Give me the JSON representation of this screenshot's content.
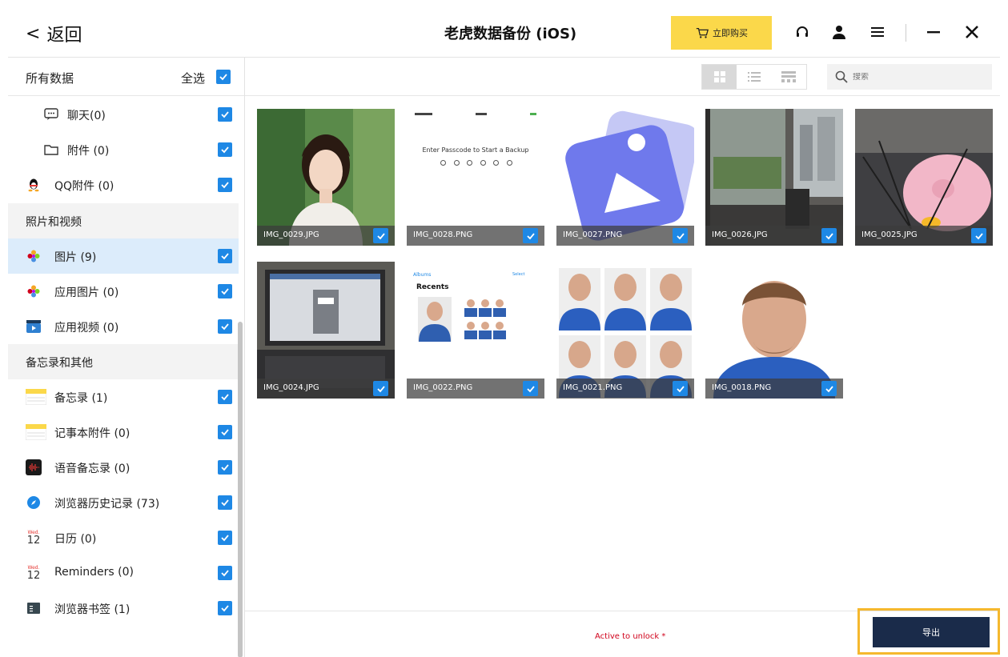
{
  "titlebar": {
    "back_label": "返回",
    "title": "老虎数据备份 (iOS)",
    "buy_label": "立即购买"
  },
  "sidebar": {
    "header_label": "所有数据",
    "select_all_label": "全选",
    "items": [
      {
        "label": "聊天(0)",
        "icon": "chat-bubble-icon",
        "type": "sub"
      },
      {
        "label": "附件 (0)",
        "icon": "folder-icon",
        "type": "sub"
      },
      {
        "label": "QQ附件 (0)",
        "icon": "qq-penguin-icon",
        "type": "item"
      }
    ],
    "section_photos": "照片和视频",
    "photo_items": [
      {
        "label": "图片 (9)",
        "icon": "photos-flower-icon"
      },
      {
        "label": "应用图片 (0)",
        "icon": "photos-flower-icon"
      },
      {
        "label": "应用视频 (0)",
        "icon": "clapperboard-icon"
      }
    ],
    "section_notes": "备忘录和其他",
    "note_items": [
      {
        "label": "备忘录 (1)",
        "icon": "notes-icon"
      },
      {
        "label": "记事本附件 (0)",
        "icon": "notes-icon"
      },
      {
        "label": "语音备忘录 (0)",
        "icon": "voice-memo-icon"
      },
      {
        "label": "浏览器历史记录 (73)",
        "icon": "safari-compass-icon"
      },
      {
        "label": "日历 (0)",
        "icon": "calendar-icon"
      },
      {
        "label": "Reminders (0)",
        "icon": "calendar-icon"
      },
      {
        "label": "浏览器书签 (1)",
        "icon": "bookmark-book-icon"
      }
    ],
    "calendar_day_label": "Wed.",
    "calendar_date": "12"
  },
  "toolbar": {
    "search_placeholder": "搜索"
  },
  "thumbnails": [
    {
      "filename": "IMG_0029.JPG"
    },
    {
      "filename": "IMG_0028.PNG",
      "screen_text": "Enter Passcode to Start a Backup"
    },
    {
      "filename": "IMG_0027.PNG"
    },
    {
      "filename": "IMG_0026.JPG"
    },
    {
      "filename": "IMG_0025.JPG"
    },
    {
      "filename": "IMG_0024.JPG"
    },
    {
      "filename": "IMG_0022.PNG",
      "screen_back": "Albums",
      "screen_select": "Select",
      "screen_title": "Recents"
    },
    {
      "filename": "IMG_0021.PNG"
    },
    {
      "filename": "IMG_0018.PNG"
    }
  ],
  "footer": {
    "notice": "Active to unlock *",
    "export_label": "导出"
  },
  "colors": {
    "accent_blue": "#1e88e5",
    "buy_yellow": "#fbd84a",
    "export_navy": "#1a2b4a",
    "highlight_orange": "#f5b82e",
    "notice_red": "#d0021b"
  }
}
